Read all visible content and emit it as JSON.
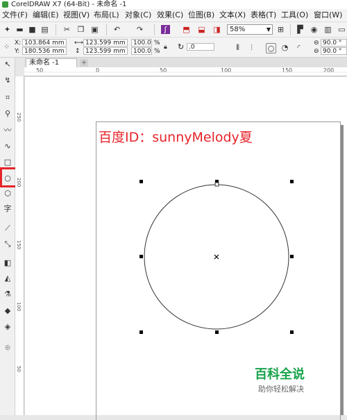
{
  "window": {
    "title": "CorelDRAW X7 (64-Bit) - 未命名 -1"
  },
  "menu": [
    "文件(F)",
    "编辑(E)",
    "视图(V)",
    "布局(L)",
    "对象(C)",
    "效果(C)",
    "位图(B)",
    "文本(X)",
    "表格(T)",
    "工具(O)",
    "窗口(W)"
  ],
  "toolbar": {
    "zoom": "58%"
  },
  "properties": {
    "x": "103.864 mm",
    "y": "180.536 mm",
    "width": "123.599 mm",
    "height": "123.599 mm",
    "scale_w": "100.0",
    "scale_h": "100.0",
    "percent": "%",
    "rotation": ".0",
    "angle_start": "90.0 °",
    "angle_end": "90.0 °",
    "x_label": "X:",
    "y_label": "Y:"
  },
  "tab": {
    "label": "未命名 -1",
    "add": "+"
  },
  "ruler": {
    "h_labels": [
      "50",
      "0",
      "50",
      "100",
      "150",
      "200"
    ],
    "v_labels": [
      "250",
      "200",
      "150",
      "100",
      "50"
    ]
  },
  "watermark": {
    "id_text": "百度ID：sunnyMelody夏"
  },
  "brand": {
    "title": "百科全说",
    "subtitle": "助你轻松解决"
  },
  "icons": [
    "new-icon",
    "open-icon",
    "save-icon",
    "print-icon",
    "cut-icon",
    "copy-icon",
    "paste-icon",
    "undo-icon",
    "redo-icon",
    "search-icon",
    "import-icon",
    "export-icon",
    "publish-icon",
    "zoom-icon",
    "fullscreen-icon",
    "settings-icon",
    "pick-tool-icon",
    "shape-tool-icon",
    "crop-tool-icon",
    "zoom-tool-icon",
    "freehand-tool-icon",
    "artistic-media-icon",
    "rectangle-tool-icon",
    "ellipse-tool-icon",
    "polygon-tool-icon",
    "text-tool-icon",
    "parallel-dimension-icon",
    "connector-tool-icon",
    "drop-shadow-icon",
    "transparency-icon",
    "eyedropper-icon",
    "fill-icon",
    "outline-icon",
    "add-tool-icon"
  ],
  "colors": {
    "accent_red": "#e8242b",
    "brand_green": "#16a34a"
  }
}
